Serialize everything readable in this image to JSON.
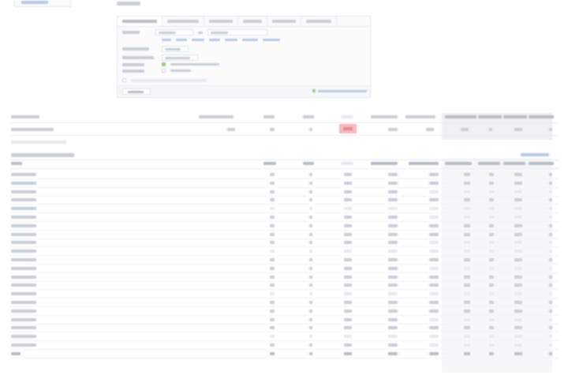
{
  "top_link": "",
  "welcome": "",
  "panel": {
    "tabs": [
      "",
      "",
      "",
      "",
      "",
      ""
    ],
    "active_tab": 0
  },
  "colors": {
    "warning_cell": "#f6b9bd",
    "link": "#b7c7e6",
    "success": "#9ccc87"
  }
}
